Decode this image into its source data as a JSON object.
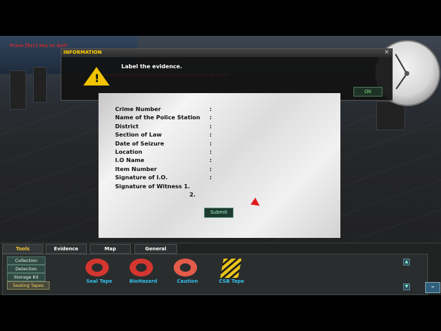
{
  "hud": {
    "quit_hint": "Press [Esc] key to Quit"
  },
  "dialog": {
    "title": "INFORMATION",
    "message": "Label the evidence.",
    "ok_label": "OK",
    "close_glyph": "×",
    "icon": "warning-icon"
  },
  "label_form": {
    "fields": [
      "Crime Number",
      "Name of the Police Station",
      "District",
      "Section of Law",
      "Date of Seizure",
      "Location",
      "I.O Name",
      "Item Number",
      "Signature of I.O.",
      "Signature of Witness 1."
    ],
    "witness_two": "2.",
    "submit_label": "Submit"
  },
  "toolbar": {
    "tabs": [
      "Tools",
      "Evidence",
      "Map",
      "General"
    ],
    "active_tab": "Tools",
    "categories": [
      "Collection",
      "Detection",
      "Storage Kit",
      "Sealing Tapes"
    ],
    "selected_category": "Sealing Tapes",
    "items": [
      {
        "label": "Seal Tape",
        "icon": "red-tape-roll-icon"
      },
      {
        "label": "BioHazard",
        "icon": "biohazard-tape-roll-icon"
      },
      {
        "label": "Caution",
        "icon": "caution-tape-roll-icon"
      },
      {
        "label": "CSB Tape",
        "icon": "crime-scene-tape-icon"
      }
    ]
  },
  "colors": {
    "accent": "#f3c33a",
    "item_label": "#34c0ef",
    "warning": "#f2c300"
  }
}
